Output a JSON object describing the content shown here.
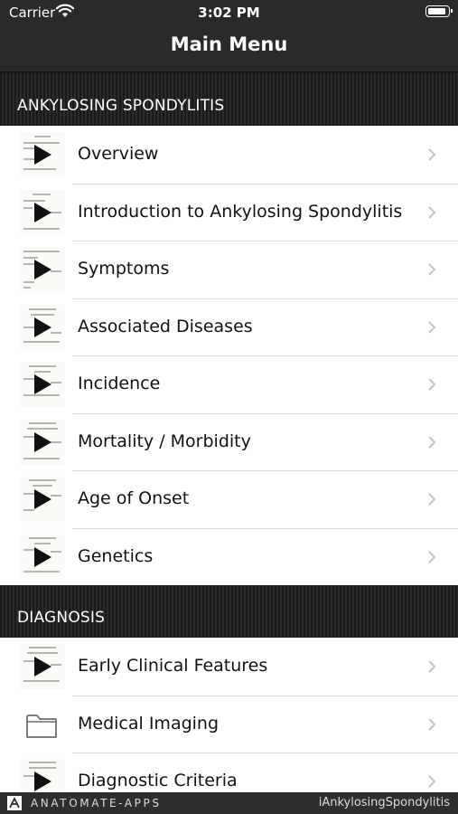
{
  "status_bar": {
    "carrier": "Carrier",
    "time": "3:02 PM"
  },
  "nav": {
    "title": "Main Menu"
  },
  "sections": [
    {
      "header": "ANKYLOSING SPONDYLITIS",
      "items": [
        {
          "label": "Overview",
          "icon": "video-thumbnail"
        },
        {
          "label": "Introduction to Ankylosing Spondylitis",
          "icon": "video-thumbnail"
        },
        {
          "label": "Symptoms",
          "icon": "video-thumbnail"
        },
        {
          "label": "Associated Diseases",
          "icon": "video-thumbnail"
        },
        {
          "label": "Incidence",
          "icon": "video-thumbnail"
        },
        {
          "label": "Mortality / Morbidity",
          "icon": "video-thumbnail"
        },
        {
          "label": "Age of Onset",
          "icon": "video-thumbnail"
        },
        {
          "label": "Genetics",
          "icon": "video-thumbnail"
        }
      ]
    },
    {
      "header": "DIAGNOSIS",
      "items": [
        {
          "label": "Early Clinical Features",
          "icon": "video-thumbnail"
        },
        {
          "label": "Medical Imaging",
          "icon": "folder-icon"
        },
        {
          "label": "Diagnostic Criteria",
          "icon": "video-thumbnail"
        }
      ]
    }
  ],
  "footer": {
    "brand": "ANATOMATE-APPS",
    "app_name": "iAnkylosingSpondylitis"
  },
  "colors": {
    "nav_bg": "#2a2a2a",
    "row_bg": "#ffffff",
    "text": "#111111",
    "chevron": "#c4c4c4"
  }
}
